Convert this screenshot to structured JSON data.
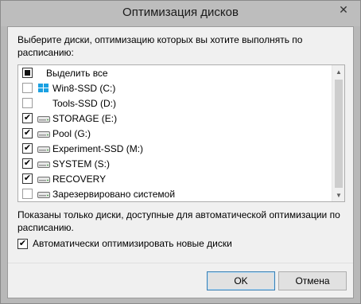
{
  "window": {
    "title": "Оптимизация дисков",
    "close_glyph": "✕"
  },
  "intro_text": "Выберите диски, оптимизацию которых вы хотите выполнять по расписанию:",
  "list": {
    "select_all": {
      "label": "Выделить все",
      "state": "mixed"
    },
    "items": [
      {
        "label": "Win8-SSD (C:)",
        "checked": false,
        "icon": "windows-drive-icon"
      },
      {
        "label": "Tools-SSD (D:)",
        "checked": false,
        "icon": "none"
      },
      {
        "label": "STORAGE (E:)",
        "checked": true,
        "icon": "hard-drive-icon"
      },
      {
        "label": "Pool (G:)",
        "checked": true,
        "icon": "hard-drive-icon"
      },
      {
        "label": "Experiment-SSD (M:)",
        "checked": true,
        "icon": "hard-drive-icon"
      },
      {
        "label": "SYSTEM (S:)",
        "checked": true,
        "icon": "hard-drive-icon"
      },
      {
        "label": "RECOVERY",
        "checked": true,
        "icon": "hard-drive-icon"
      },
      {
        "label": "Зарезервировано системой",
        "checked": false,
        "icon": "hard-drive-icon"
      }
    ]
  },
  "note_text": "Показаны только диски, доступные для автоматической оптимизации по расписанию.",
  "auto_optimize": {
    "label": "Автоматически оптимизировать новые диски",
    "checked": true
  },
  "buttons": {
    "ok": "OK",
    "cancel": "Отмена"
  },
  "colors": {
    "titlebar": "#bdbdbd",
    "client": "#f0f0f0",
    "ok_border": "#3c7fb1"
  }
}
